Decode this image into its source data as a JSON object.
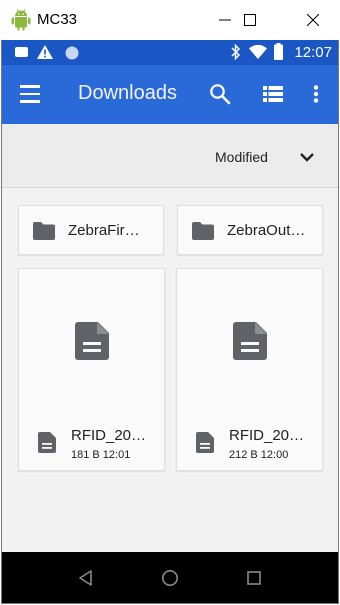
{
  "window": {
    "title": "MC33",
    "minimize_glyph": "—",
    "maximize_glyph": "☐",
    "close_glyph": "✕"
  },
  "statusbar": {
    "time": "12:07",
    "left_icons": [
      "message-notification-icon",
      "warning-icon",
      "circle-notification-icon"
    ],
    "right_icons": [
      "bluetooth-icon",
      "wifi-icon",
      "battery-icon"
    ]
  },
  "appbar": {
    "title": "Downloads",
    "icons": [
      "menu-icon",
      "search-icon",
      "list-view-icon",
      "more-options-icon"
    ],
    "color": "#2a6ad8"
  },
  "sort": {
    "label": "Modified"
  },
  "folders": [
    {
      "name": "ZebraFir…"
    },
    {
      "name": "ZebraOut…"
    }
  ],
  "files": [
    {
      "name": "RFID_20…",
      "meta": "181 B 12:01"
    },
    {
      "name": "RFID_20…",
      "meta": "212 B 12:00"
    }
  ],
  "navbar": {
    "icons": [
      "back-icon",
      "home-icon",
      "recents-icon"
    ]
  },
  "colors": {
    "statusbar": "#1b57c4",
    "appbar": "#2a6ad8",
    "icon_gray": "#5f6368"
  }
}
